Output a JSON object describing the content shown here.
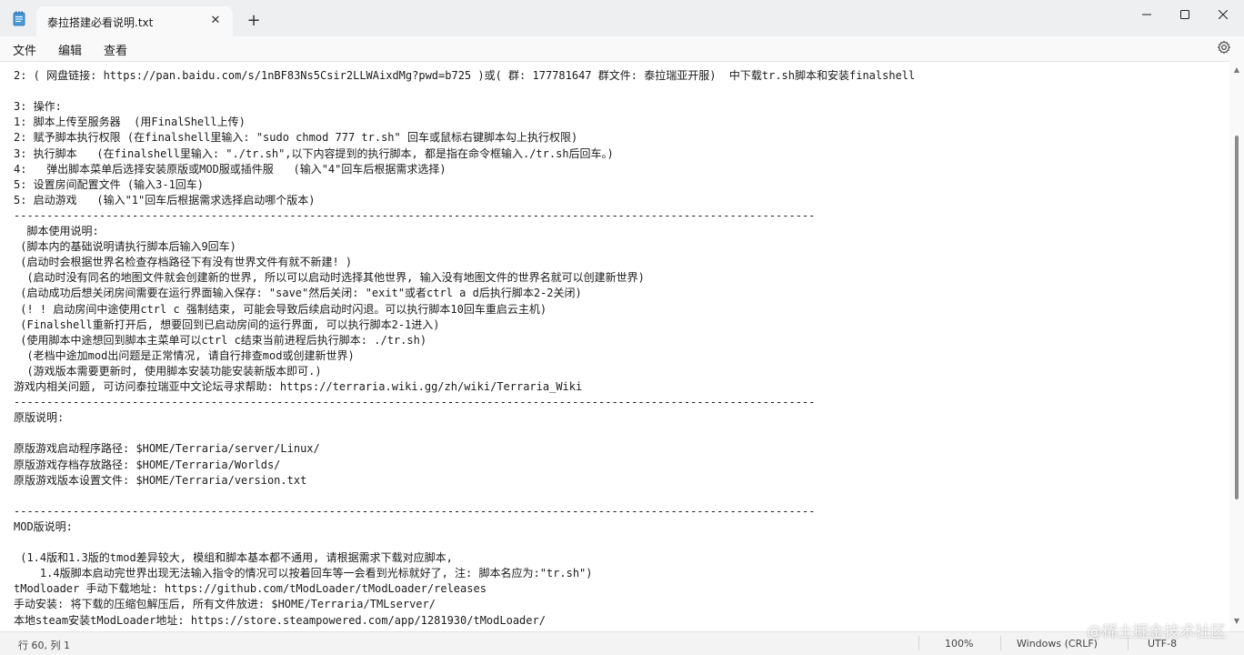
{
  "window": {
    "tab_title": "泰拉搭建必看说明.txt",
    "tab_close": "✕",
    "new_tab": "+",
    "minimize": "—",
    "maximize": "□",
    "close": "✕"
  },
  "menu": {
    "file": "文件",
    "edit": "编辑",
    "view": "查看"
  },
  "editor": {
    "lines": [
      "2: ( 网盘链接: https://pan.baidu.com/s/1nBF83Ns5Csir2LLWAixdMg?pwd=b725 )或( 群: 177781647 群文件: 泰拉瑞亚开服)  中下载tr.sh脚本和安装finalshell",
      "",
      "3: 操作:",
      "1: 脚本上传至服务器  (用FinalShell上传)",
      "2: 赋予脚本执行权限 (在finalshell里输入: \"sudo chmod 777 tr.sh\" 回车或鼠标右键脚本勾上执行权限)",
      "3: 执行脚本   (在finalshell里输入: \"./tr.sh\",以下内容提到的执行脚本, 都是指在命令框输入./tr.sh后回车。)",
      "4:   弹出脚本菜单后选择安装原版或MOD服或插件服   (输入\"4\"回车后根据需求选择)",
      "5: 设置房间配置文件 (输入3-1回车)",
      "5: 启动游戏   (输入\"1\"回车后根据需求选择启动哪个版本)",
      "--------------------------------------------------------------------------------------------------------------------------",
      "  脚本使用说明:",
      " (脚本内的基础说明请执行脚本后输入9回车)",
      " (启动时会根据世界名检查存档路径下有没有世界文件有就不新建! )",
      "  (启动时没有同名的地图文件就会创建新的世界, 所以可以启动时选择其他世界, 输入没有地图文件的世界名就可以创建新世界)",
      " (启动成功后想关闭房间需要在运行界面输入保存: \"save\"然后关闭: \"exit\"或者ctrl a d后执行脚本2-2关闭)",
      " (! ! 启动房间中途使用ctrl c 强制结束, 可能会导致后续启动时闪退。可以执行脚本10回车重启云主机)",
      " (Finalshell重新打开后, 想要回到已启动房间的运行界面, 可以执行脚本2-1进入)",
      " (使用脚本中途想回到脚本主菜单可以ctrl c结束当前进程后执行脚本: ./tr.sh)",
      "  (老档中途加mod出问题是正常情况, 请自行排查mod或创建新世界)",
      "  (游戏版本需要更新时, 使用脚本安装功能安装新版本即可.)",
      "游戏内相关问题, 可访问泰拉瑞亚中文论坛寻求帮助: https://terraria.wiki.gg/zh/wiki/Terraria_Wiki",
      "--------------------------------------------------------------------------------------------------------------------------",
      "原版说明:",
      "",
      "原版游戏启动程序路径: $HOME/Terraria/server/Linux/",
      "原版游戏存档存放路径: $HOME/Terraria/Worlds/",
      "原版游戏版本设置文件: $HOME/Terraria/version.txt",
      "",
      "--------------------------------------------------------------------------------------------------------------------------",
      "MOD版说明:",
      "",
      " (1.4版和1.3版的tmod差异较大, 模组和脚本基本都不通用, 请根据需求下载对应脚本,",
      "    1.4版脚本启动完世界出现无法输入指令的情况可以按着回车等一会看到光标就好了, 注: 脚本名应为:\"tr.sh\")",
      "tModloader 手动下载地址: https://github.com/tModLoader/tModLoader/releases",
      "手动安装: 将下载的压缩包解压后, 所有文件放进: $HOME/Terraria/TMLserver/",
      "本地steam安装tModLoader地址: https://store.steampowered.com/app/1281930/tModLoader/"
    ]
  },
  "status": {
    "position": "行 60, 列 1",
    "zoom": "100%",
    "line_ending": "Windows (CRLF)",
    "encoding": "UTF-8"
  },
  "watermark": "@稀土掘金技术社区",
  "icons": {
    "app": "notepad-icon",
    "settings": "gear-icon"
  },
  "colors": {
    "titlebar": "#eeeff1",
    "tab": "#f9f9f9",
    "statusbar": "#f3f3f3",
    "accent": "#0067c0"
  }
}
